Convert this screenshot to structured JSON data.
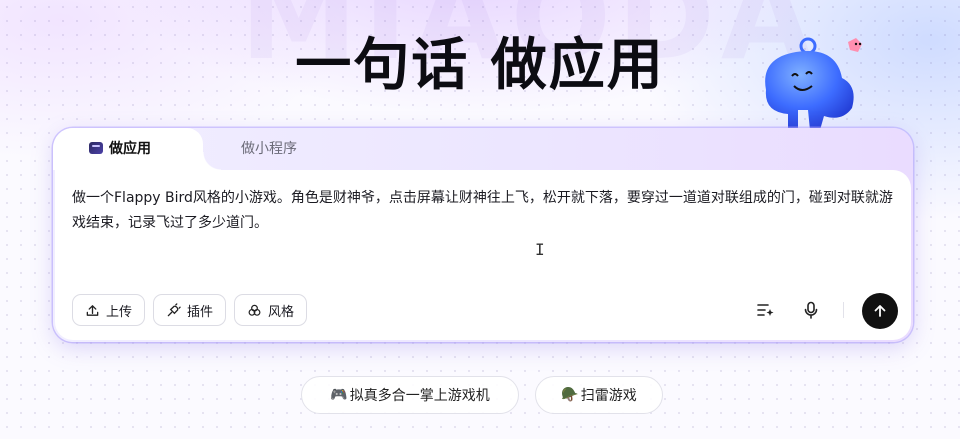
{
  "brand_watermark": "MIAODA",
  "hero": {
    "title": "一句话 做应用"
  },
  "tabs": [
    {
      "label": "做应用",
      "active": true
    },
    {
      "label": "做小程序",
      "active": false
    }
  ],
  "prompt": {
    "text": "做一个Flappy Bird风格的小游戏。角色是财神爷，点击屏幕让财神往上飞，松开就下落，要穿过一道道对联组成的门，碰到对联就游戏结束，记录飞过了多少道门。"
  },
  "toolbar": {
    "upload_label": "上传",
    "plugin_label": "插件",
    "style_label": "风格"
  },
  "suggestions": [
    {
      "emoji": "🎮",
      "label": "拟真多合一掌上游戏机"
    },
    {
      "emoji": "🪖",
      "label": "扫雷游戏"
    }
  ],
  "icons": {
    "upload": "upload-icon",
    "plugin": "plugin-icon",
    "style": "style-icon",
    "list": "list-sparkle-icon",
    "mic": "microphone-icon",
    "send": "arrow-up-icon"
  },
  "colors": {
    "accent": "#8b73f0",
    "send": "#111111"
  }
}
